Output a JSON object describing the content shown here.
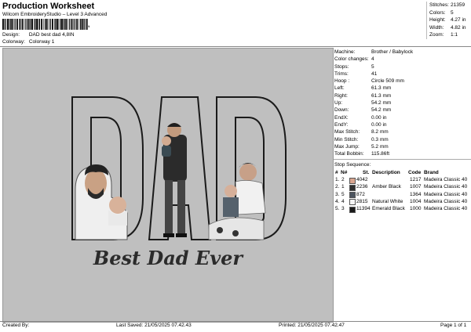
{
  "header": {
    "title": "Production Worksheet",
    "subtitle": "Wilcom EmbroideryStudio – Level 3 Advanced",
    "barcode_suffix": ",",
    "design_label": "Design:",
    "design_value": "DAD best dad 4,8IN",
    "colorway_label": "Colorway:",
    "colorway_value": "Colorway 1"
  },
  "stats": {
    "stitches_label": "Stitches:",
    "stitches": "21359",
    "colors_label": "Colors:",
    "colors": "5",
    "height_label": "Height:",
    "height": "4.27 in",
    "width_label": "Width:",
    "width": "4.82 in",
    "zoom_label": "Zoom:",
    "zoom": "1:1"
  },
  "design": {
    "letters": "DAD",
    "caption": "Best Dad Ever"
  },
  "details": [
    {
      "k": "Machine:",
      "v": "Brother / Babylock"
    },
    {
      "k": "Color changes:",
      "v": "4"
    },
    {
      "k": "Stops:",
      "v": "5"
    },
    {
      "k": "Trims:",
      "v": "41"
    },
    {
      "k": "Hoop :",
      "v": "Circle 509 mm"
    },
    {
      "k": "Left:",
      "v": "61.3 mm"
    },
    {
      "k": "Right:",
      "v": "61.3 mm"
    },
    {
      "k": "Up:",
      "v": "54.2 mm"
    },
    {
      "k": "Down:",
      "v": "54.2 mm"
    },
    {
      "k": "EndX:",
      "v": "0.00 in"
    },
    {
      "k": "EndY:",
      "v": "0.00 in"
    },
    {
      "k": "Max Stitch:",
      "v": "8.2 mm"
    },
    {
      "k": "Min Stitch:",
      "v": "0.3 mm"
    },
    {
      "k": "Max Jump:",
      "v": "5.2 mm"
    },
    {
      "k": "Total Bobbin:",
      "v": "115.86ft"
    }
  ],
  "stop_sequence": {
    "title": "Stop Sequence:",
    "headers": {
      "num": "#",
      "n": "N#",
      "st": "St.",
      "desc": "Description",
      "code": "Code",
      "brand": "Brand"
    },
    "rows": [
      {
        "num": "1.",
        "n": "2",
        "color": "#d9a58f",
        "st": "4042",
        "desc": "",
        "code": "1217",
        "brand": "Madeira Classic 40"
      },
      {
        "num": "2.",
        "n": "1",
        "color": "#2f2f2f",
        "st": "2236",
        "desc": "Amber Black",
        "code": "1007",
        "brand": "Madeira Classic 40"
      },
      {
        "num": "3.",
        "n": "5",
        "color": "#4d5560",
        "st": "872",
        "desc": "",
        "code": "1364",
        "brand": "Madeira Classic 40"
      },
      {
        "num": "4.",
        "n": "4",
        "color": "#f4f4f4",
        "st": "2815",
        "desc": "Natural White",
        "code": "1004",
        "brand": "Madeira Classic 40"
      },
      {
        "num": "5.",
        "n": "3",
        "color": "#1a1a1a",
        "st": "11394",
        "desc": "Emerald Black",
        "code": "1000",
        "brand": "Madeira Classic 40"
      }
    ]
  },
  "footer": {
    "created_by": "Created By:",
    "last_saved": "Last Saved: 21/05/2025 07.42.43",
    "printed": "Printed: 21/05/2025 07.42.47",
    "page": "Page 1 of 1"
  }
}
